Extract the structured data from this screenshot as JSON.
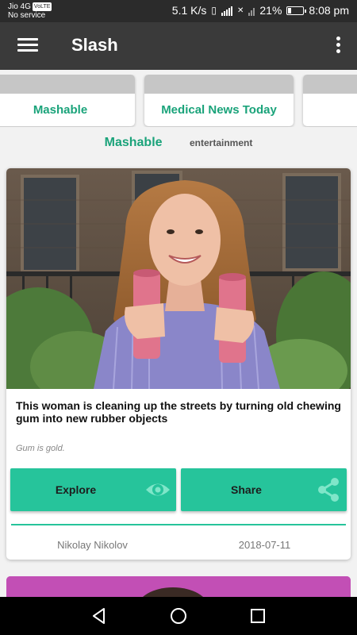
{
  "status_bar": {
    "carrier": "Jio 4G",
    "volte_badge": "VoLTE",
    "service": "No service",
    "speed": "5.1 K/s",
    "battery_percent": "21%",
    "battery_level": 0.21,
    "time": "8:08 pm"
  },
  "app_bar": {
    "title": "Slash",
    "menu_icon": "hamburger-menu-icon",
    "overflow_icon": "more-vert-icon"
  },
  "sources": [
    {
      "label": "Mashable"
    },
    {
      "label": "Medical News Today"
    },
    {
      "label": ""
    }
  ],
  "selected_source": {
    "name": "Mashable",
    "category": "entertainment"
  },
  "article": {
    "title": "This woman is cleaning up the streets by turning old chewing gum into new rubber objects",
    "description": "Gum is gold.",
    "explore_label": "Explore",
    "share_label": "Share",
    "author": "Nikolay Nikolov",
    "date": "2018-07-11"
  },
  "colors": {
    "accent": "#1aa37a",
    "button": "#26c49b",
    "app_bar": "#3a3a3a",
    "status_bar": "#2b2b2b"
  }
}
